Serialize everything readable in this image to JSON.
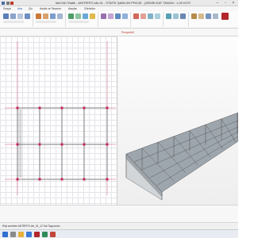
{
  "app": {
    "title": "ideCAD Statik - ANTREPO.ide-01 - STATİK ŞABLON PROJE - [ZEMİN KAT TAVANI : 1.00 KOTU]"
  },
  "ribbon": {
    "tabs": [
      "Dosya",
      "Ana",
      "Çiz",
      "Analiz ve Tasarım",
      "Araçlar",
      "Görünüm"
    ],
    "active_tab": "Ana"
  },
  "views": {
    "right_label": "Perspektif"
  },
  "status": {
    "text": "Ekşi zeminler ANTREPO.ide_01_12 Kat Taşıyıcıları"
  },
  "icons": [
    "undo-icon",
    "redo-icon",
    "save-icon",
    "column-tool-icon",
    "beam-tool-icon",
    "slab-tool-icon",
    "wall-tool-icon",
    "foundation-tool-icon",
    "analysis-icon",
    "report-icon",
    "drawing-icon",
    "window-minimize-icon",
    "window-maximize-icon",
    "window-close-icon"
  ],
  "colors": {
    "accent": "#1e5aa8",
    "grid_axis": "#d1244f",
    "beam": "#8a8a8a",
    "frame_3d": "#555555"
  }
}
